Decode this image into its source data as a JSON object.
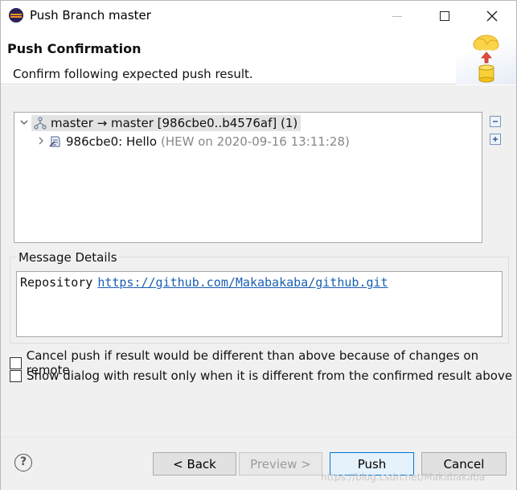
{
  "window": {
    "title": "Push Branch master",
    "icon": "eclipse-icon"
  },
  "banner": {
    "title": "Push Confirmation",
    "subtitle": "Confirm following expected push result.",
    "art": "cloud-push-database-icon"
  },
  "tree": {
    "rows": [
      {
        "icon": "branch-icon",
        "label": "master → master [986cbe0..b4576af] (1)",
        "expanded": true
      },
      {
        "icon": "commit-icon",
        "label": "986cbe0: Hello",
        "meta": "(HEW on 2020-09-16 13:11:28)",
        "expanded": false
      }
    ]
  },
  "message_details": {
    "label": "Message Details",
    "prefix": "Repository",
    "link": "https://github.com/Makabakaba/github.git"
  },
  "options": {
    "cancel_if_different": "Cancel push if result would be different than above because of changes on remote",
    "show_dialog_only_if_different": "Show dialog with result only when it is different from the confirmed result above"
  },
  "footer": {
    "back": "< Back",
    "preview": "Preview >",
    "push": "Push",
    "cancel": "Cancel",
    "watermark": "https://blog.csdn.net/Makabakaba"
  },
  "colors": {
    "link": "#1a5fb4",
    "default_button_border": "#0078d7",
    "dialog_bg": "#f0f0f0"
  }
}
